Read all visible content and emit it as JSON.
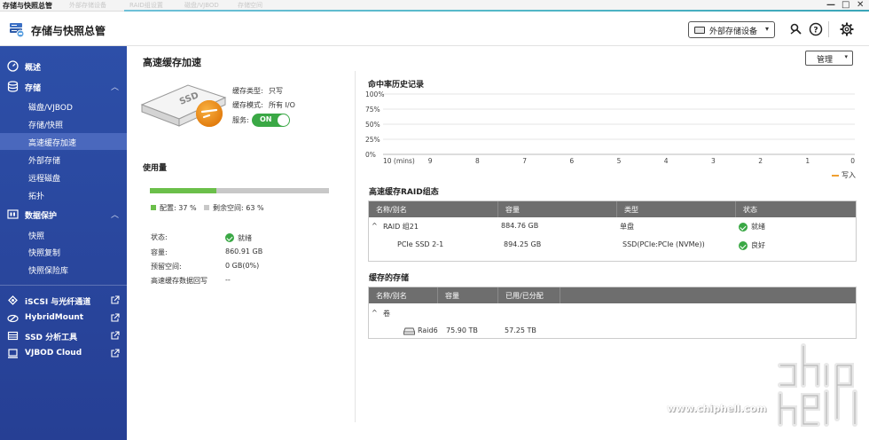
{
  "window": {
    "title": "存储与快照总管",
    "ghost_tabs": [
      "外部存储设备",
      "RAID组设置",
      "磁盘/VJBOD",
      "存储空间"
    ],
    "minimize": "—",
    "maximize": "□",
    "close": "✕"
  },
  "header": {
    "app_title": "存储与快照总管",
    "external_device_label": "外部存储设备",
    "icons": [
      "search-tools-icon",
      "help-icon",
      "settings-gear-icon"
    ]
  },
  "sidebar": {
    "overview": "概述",
    "storage": "存储",
    "storage_items": [
      "磁盘/VJBOD",
      "存储/快照",
      "高速缓存加速",
      "外部存储",
      "远程磁盘",
      "拓扑"
    ],
    "active_item": "高速缓存加速",
    "data_protection": "数据保护",
    "protection_items": [
      "快照",
      "快照复制",
      "快照保险库"
    ],
    "apps": [
      "iSCSI 与光纤通道",
      "HybridMount",
      "SSD 分析工具",
      "VJBOD Cloud"
    ]
  },
  "page": {
    "title": "高速缓存加速",
    "manage_label": "管理"
  },
  "cache_info": {
    "type_label": "缓存类型:",
    "type_value": "只写",
    "mode_label": "缓存模式:",
    "mode_value": "所有 I/O",
    "service_label": "服务:",
    "service_toggle": "ON",
    "ssd_label": "SSD"
  },
  "usage": {
    "heading": "使用量",
    "allocated_fraction": 0.37,
    "allocated_label": "配置: 37 %",
    "free_label": "剩余空间: 63 %",
    "allocated_color": "#6bbf4a",
    "free_color": "#c8c8c8",
    "status_label": "状态:",
    "status_value": "就绪",
    "capacity_label": "容量:",
    "capacity_value": "860.91 GB",
    "reserved_label": "预留空间:",
    "reserved_value": "0 GB(0%)",
    "writeback_label": "高速缓存数据回写",
    "writeback_value": "--"
  },
  "chart_data": {
    "type": "line",
    "title": "命中率历史记录",
    "xlabel": "",
    "ylabel": "",
    "x_ticks": [
      "10 (mins)",
      "9",
      "8",
      "7",
      "6",
      "5",
      "4",
      "3",
      "2",
      "1",
      "0"
    ],
    "y_ticks": [
      "100%",
      "75%",
      "50%",
      "25%",
      "0%"
    ],
    "ylim": [
      0,
      100
    ],
    "grid": true,
    "legend_position": "bottom-right",
    "series": [
      {
        "name": "写入",
        "color": "#f0a030",
        "values": []
      }
    ]
  },
  "raid_table": {
    "heading": "高速缓存RAID组态",
    "columns": [
      "名称/别名",
      "容量",
      "类型",
      "状态"
    ],
    "rows": [
      {
        "name": "RAID 组21",
        "capacity": "884.76 GB",
        "type": "单盘",
        "status": "就绪",
        "expand": "^"
      },
      {
        "name": "PCIe SSD 2-1",
        "capacity": "894.25 GB",
        "type": "SSD(PCIe:PCIe (NVMe))",
        "status": "良好"
      }
    ]
  },
  "cached_table": {
    "heading": "缓存的存储",
    "columns": [
      "名称/别名",
      "容量",
      "已用/已分配"
    ],
    "group_label": "卷",
    "rows": [
      {
        "name": "Raid6",
        "capacity": "75.90 TB",
        "used": "57.25 TB"
      }
    ]
  },
  "watermark": {
    "url": "www.chiphell.com"
  }
}
